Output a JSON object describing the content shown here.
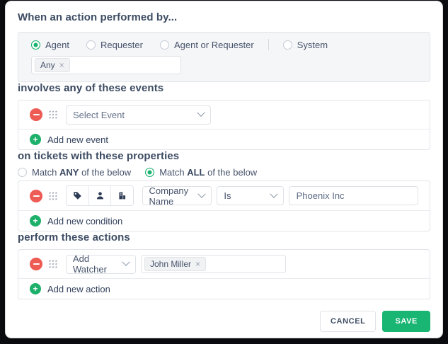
{
  "colors": {
    "accent_green": "#18b573",
    "danger_red": "#ee5a54",
    "heading_text": "#3d4c63",
    "panel_bg": "#f5f6f8"
  },
  "icons": {
    "plus": "+",
    "close": "×"
  },
  "performed_by": {
    "heading": "When an action performed by...",
    "options": [
      {
        "label": "Agent",
        "selected": true
      },
      {
        "label": "Requester",
        "selected": false
      },
      {
        "label": "Agent or Requester",
        "selected": false
      },
      {
        "label": "System",
        "selected": false
      }
    ],
    "value_chip": "Any"
  },
  "events": {
    "heading_pre": "involves ",
    "heading_bold": "any",
    "heading_post": " of these events",
    "select_placeholder": "Select Event",
    "add_label": "Add new event"
  },
  "conditions": {
    "heading": "on tickets with these properties",
    "match_any": {
      "pre": "Match ",
      "bold": "ANY",
      "post": " of the below"
    },
    "match_all": {
      "pre": "Match ",
      "bold": "ALL",
      "post": " of the below"
    },
    "row": {
      "icon_names": [
        "ticket-tag-icon",
        "requester-person-icon",
        "company-building-icon"
      ],
      "field": "Company Name",
      "operator": "Is",
      "value": "Phoenix Inc"
    },
    "add_label": "Add new condition"
  },
  "actions": {
    "heading": "perform these actions",
    "row": {
      "action": "Add Watcher",
      "chip": "John Miller"
    },
    "add_label": "Add new action"
  },
  "footer": {
    "cancel": "CANCEL",
    "save": "SAVE"
  }
}
